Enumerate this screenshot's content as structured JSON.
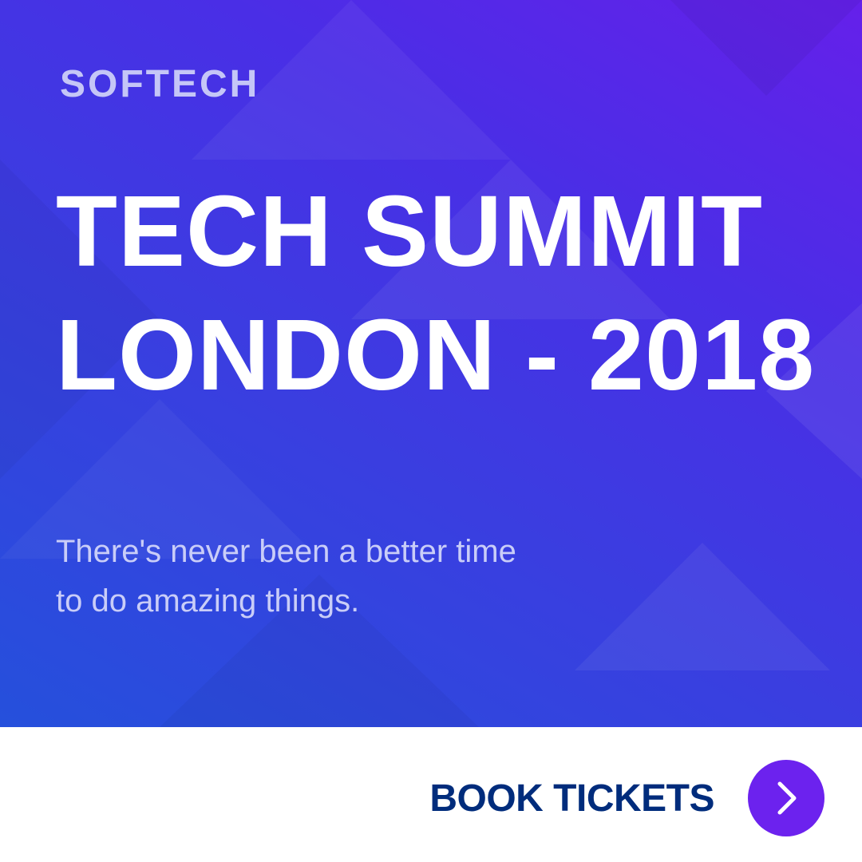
{
  "brand": {
    "logo": "SOFTECH"
  },
  "hero": {
    "title_line1": "TECH SUMMIT",
    "title_line2": "LONDON - 2018",
    "subtitle_line1": "There's never been a better time",
    "subtitle_line2": "to do amazing things."
  },
  "cta": {
    "label": "BOOK TICKETS",
    "icon": "chevron-right-icon"
  },
  "colors": {
    "cta_text": "#002c7c",
    "cta_circle": "#6c22ee",
    "logo": "#c5c6f7"
  }
}
